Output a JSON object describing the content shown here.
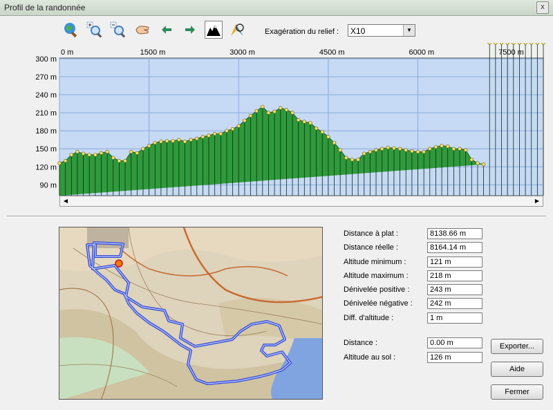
{
  "window": {
    "title": "Profil de la randonnée",
    "close_glyph": "x"
  },
  "toolbar": {
    "icons": [
      "globe-zoom-icon",
      "zoom-in-icon",
      "zoom-out-icon",
      "hand-pan-icon",
      "arrow-left-icon",
      "arrow-right-icon",
      "relief-profile-icon",
      "compass-zoom-icon"
    ],
    "relief_label": "Exagération du relief :",
    "relief_value": "X10"
  },
  "chart_data": {
    "type": "area",
    "x_unit": "m",
    "x_ticks": [
      "0 m",
      "1500 m",
      "3000 m",
      "4500 m",
      "6000 m",
      "7500 m"
    ],
    "x_tick_values": [
      0,
      1500,
      3000,
      4500,
      6000,
      7500
    ],
    "y_ticks": [
      "300 m",
      "270 m",
      "240 m",
      "210 m",
      "180 m",
      "150 m",
      "120 m",
      "90 m"
    ],
    "y_tick_values": [
      300,
      270,
      240,
      210,
      180,
      150,
      120,
      90
    ],
    "xlim": [
      0,
      8100
    ],
    "ylim": [
      72,
      301
    ],
    "grid": true,
    "colors": {
      "plot_bg": "#c6daf5",
      "fill": "#2f9a3c",
      "grid": "#8aa8d8",
      "marker": "#f2e36a"
    },
    "x": [
      0,
      100,
      200,
      300,
      400,
      500,
      600,
      700,
      800,
      900,
      1000,
      1100,
      1200,
      1300,
      1400,
      1500,
      1600,
      1700,
      1800,
      1900,
      2000,
      2100,
      2200,
      2300,
      2400,
      2500,
      2600,
      2700,
      2800,
      2900,
      3000,
      3100,
      3200,
      3300,
      3400,
      3500,
      3600,
      3700,
      3800,
      3900,
      4000,
      4100,
      4200,
      4300,
      4400,
      4500,
      4600,
      4700,
      4800,
      4900,
      5000,
      5100,
      5200,
      5300,
      5400,
      5500,
      5600,
      5700,
      5800,
      5900,
      6000,
      6100,
      6200,
      6300,
      6400,
      6500,
      6600,
      6700,
      6800,
      6900,
      7000,
      7100,
      7200,
      7300,
      7400,
      7500,
      7600,
      7700,
      7800,
      7900,
      8000,
      8100
    ],
    "y": [
      126,
      130,
      140,
      145,
      142,
      140,
      140,
      143,
      145,
      135,
      130,
      130,
      145,
      143,
      150,
      155,
      160,
      162,
      163,
      163,
      165,
      162,
      165,
      167,
      170,
      172,
      175,
      175,
      180,
      183,
      188,
      197,
      205,
      213,
      220,
      210,
      212,
      218,
      215,
      210,
      198,
      195,
      193,
      184,
      178,
      170,
      160,
      148,
      135,
      132,
      132,
      142,
      145,
      148,
      150,
      152,
      151,
      150,
      148,
      146,
      145,
      145,
      150,
      153,
      155,
      154,
      150,
      150,
      148,
      132,
      126,
      124
    ]
  },
  "stats": [
    {
      "label": "Distance à plat :",
      "value": "8138.66 m"
    },
    {
      "label": "Distance réelle :",
      "value": "8164.14 m"
    },
    {
      "label": "Altitude minimum :",
      "value": "121 m"
    },
    {
      "label": "Altitude maximum :",
      "value": "218 m"
    },
    {
      "label": "Dénivelée positive :",
      "value": "243 m"
    },
    {
      "label": "Dénivelée négative :",
      "value": "242 m"
    },
    {
      "label": "Diff. d'altitude :",
      "value": "1 m"
    }
  ],
  "cursor": [
    {
      "label": "Distance :",
      "value": "0.00 m"
    },
    {
      "label": "Altitude au sol :",
      "value": "126 m"
    }
  ],
  "buttons": {
    "export": "Exporter...",
    "help": "Aide",
    "close": "Fermer"
  }
}
